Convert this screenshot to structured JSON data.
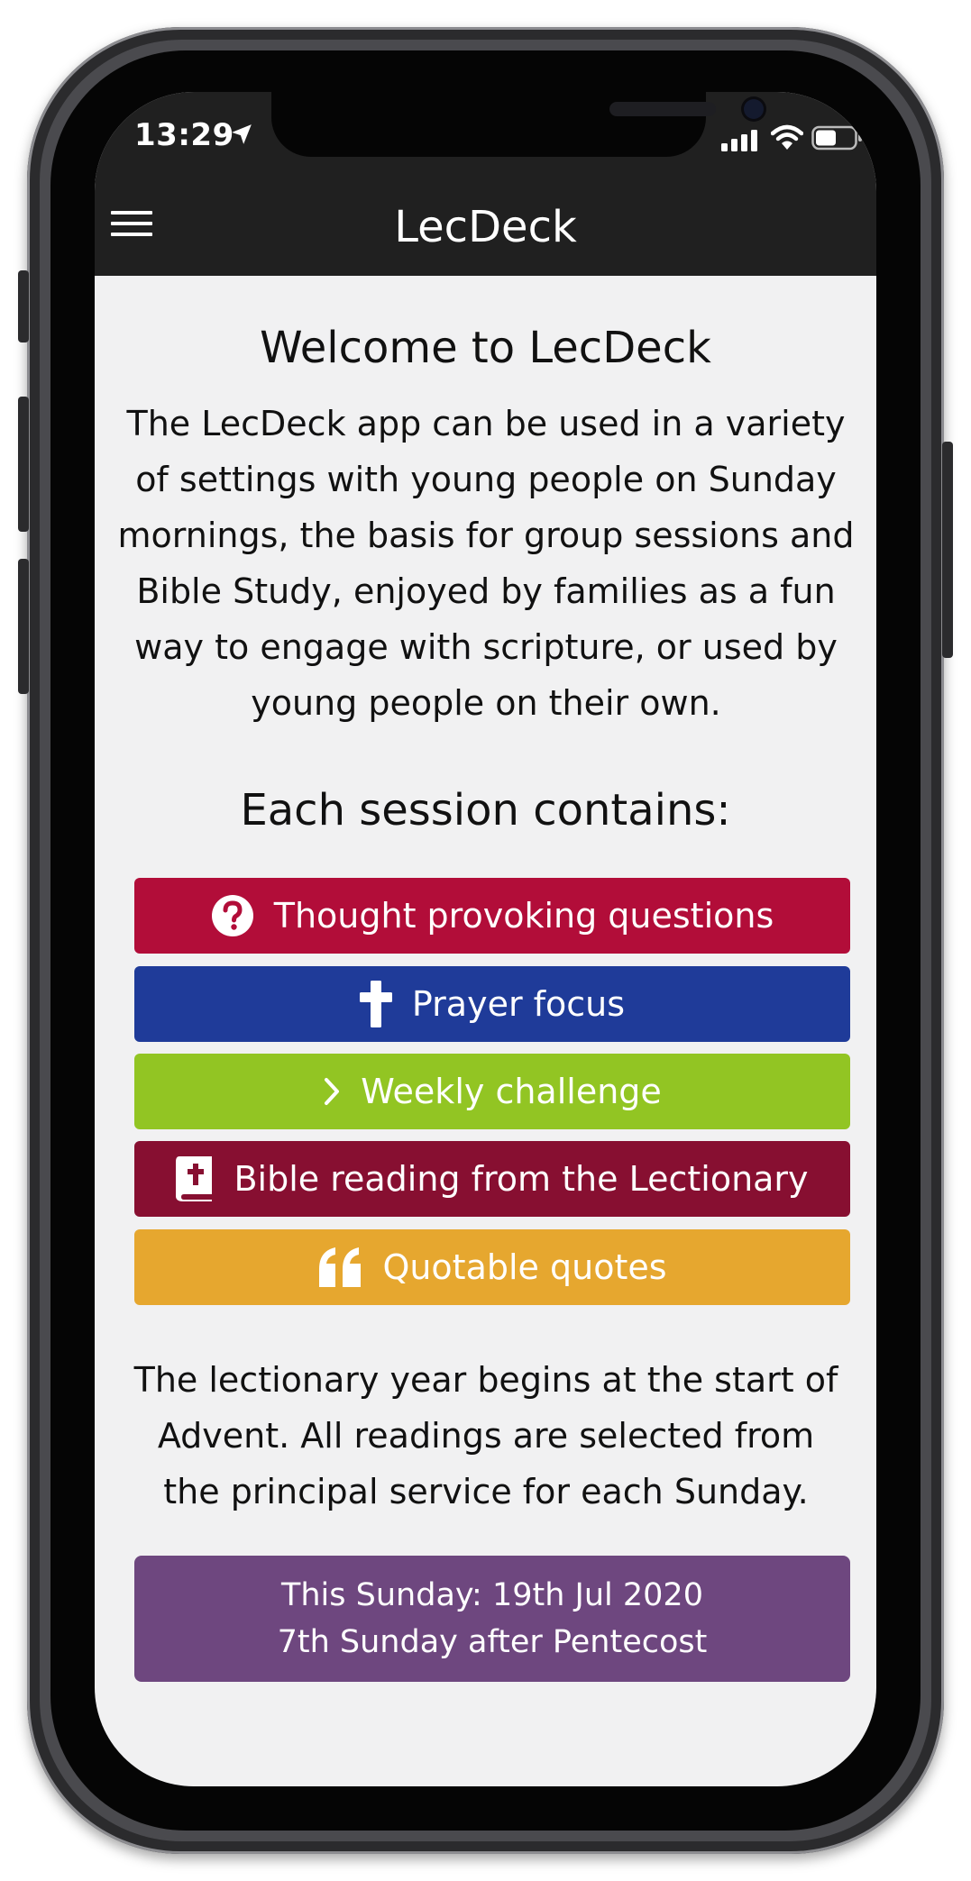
{
  "status_bar": {
    "time": "13:29"
  },
  "nav": {
    "title": "LecDeck"
  },
  "main": {
    "heading": "Welcome to LecDeck",
    "intro": "The LecDeck app can be used in a variety of settings with young people on Sunday mornings, the basis for group sessions and Bible Study, enjoyed by families as a fun way to engage with scripture, or used by young people on their own.",
    "section_heading": "Each session contains:",
    "features": [
      {
        "label": "Thought provoking questions",
        "icon": "question-circle-icon",
        "color": "#b20d39"
      },
      {
        "label": "Prayer focus",
        "icon": "cross-icon",
        "color": "#1f3b99"
      },
      {
        "label": "Weekly challenge",
        "icon": "chevron-right-icon",
        "color": "#92c523"
      },
      {
        "label": "Bible reading from the Lectionary",
        "icon": "bible-icon",
        "color": "#870f31"
      },
      {
        "label": "Quotable quotes",
        "icon": "quote-icon",
        "color": "#e6a72f"
      }
    ],
    "lectionary_note": "The lectionary year begins at the start of Advent. All readings are selected from the principal service for each Sunday.",
    "sunday_box": {
      "line1": "This Sunday: 19th Jul 2020",
      "line2": "7th Sunday after Pentecost",
      "color": "#6e477f"
    }
  }
}
